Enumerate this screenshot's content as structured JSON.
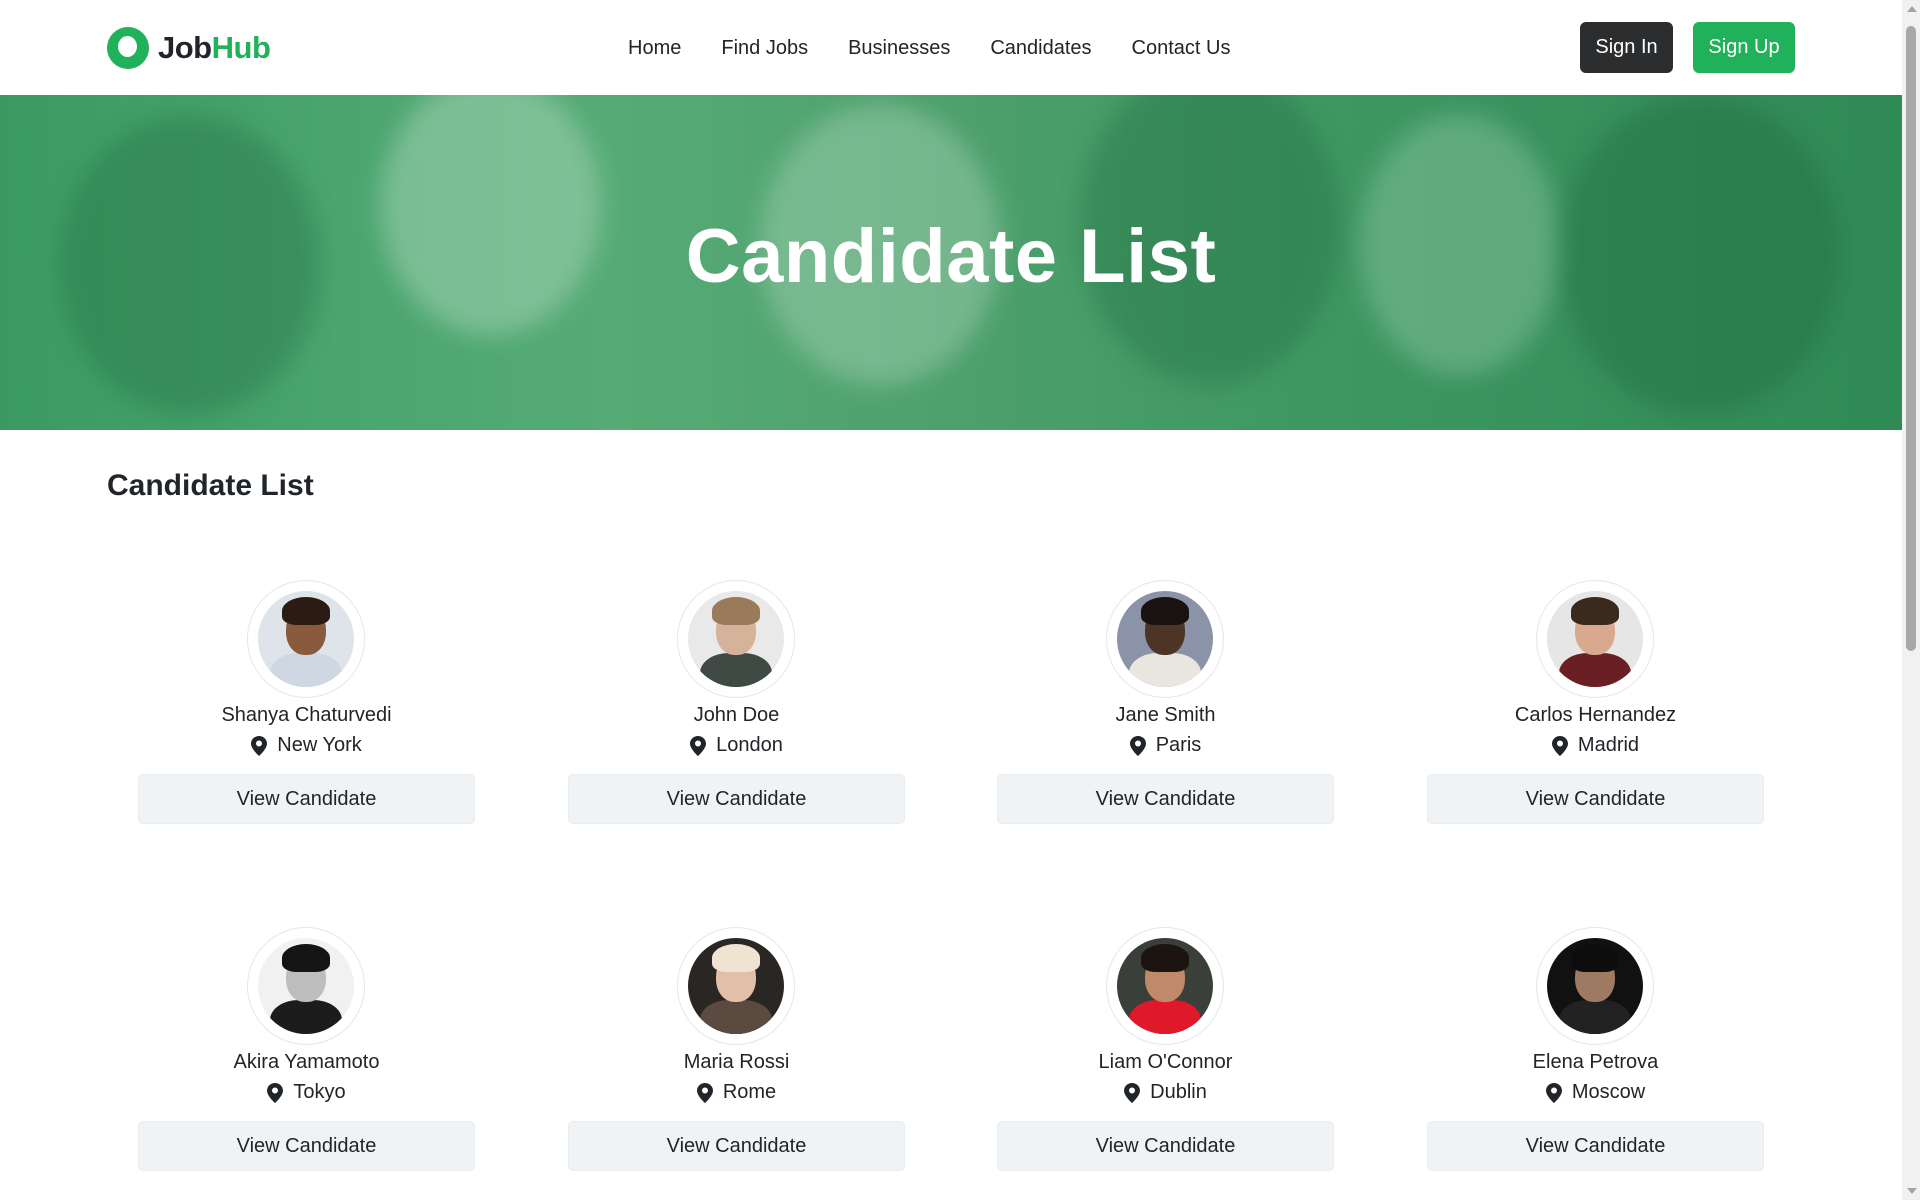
{
  "brand": {
    "part1": "Job",
    "part2": "Hub",
    "accent": "#20b15a"
  },
  "nav": [
    {
      "label": "Home"
    },
    {
      "label": "Find Jobs"
    },
    {
      "label": "Businesses"
    },
    {
      "label": "Candidates"
    },
    {
      "label": "Contact Us"
    }
  ],
  "auth": {
    "signin": "Sign In",
    "signup": "Sign Up"
  },
  "hero": {
    "title": "Candidate List"
  },
  "section": {
    "title": "Candidate List"
  },
  "view_label": "View Candidate",
  "candidates": [
    {
      "name": "Shanya Chaturvedi",
      "location": "New York"
    },
    {
      "name": "John Doe",
      "location": "London"
    },
    {
      "name": "Jane Smith",
      "location": "Paris"
    },
    {
      "name": "Carlos Hernandez",
      "location": "Madrid"
    },
    {
      "name": "Akira Yamamoto",
      "location": "Tokyo"
    },
    {
      "name": "Maria Rossi",
      "location": "Rome"
    },
    {
      "name": "Liam O'Connor",
      "location": "Dublin"
    },
    {
      "name": "Elena Petrova",
      "location": "Moscow"
    }
  ]
}
